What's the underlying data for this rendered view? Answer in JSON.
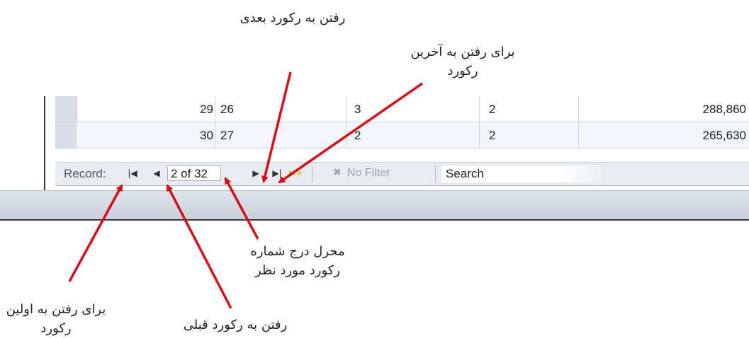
{
  "table": {
    "rows": [
      {
        "selector": "",
        "col1": "29",
        "col2": "26",
        "col3": "3",
        "col4": "2",
        "col5": "288,860"
      },
      {
        "selector": "",
        "col1": "30",
        "col2": "27",
        "col3": "2",
        "col4": "2",
        "col5": "265,630"
      }
    ]
  },
  "navbar": {
    "record_label": "Record:",
    "record_value": "2 of 32",
    "filter_label": "No Filter",
    "search_label": "Search",
    "icons": [
      "first-record-icon",
      "previous-record-icon",
      "next-record-icon",
      "last-record-icon",
      "new-record-icon",
      "filter-icon"
    ]
  },
  "annotations": {
    "next_record": "رفتن به رکورد بعدی",
    "last_record": "برای رفتن به آخرین رکورد",
    "record_input": "محرل درج شماره رکورد مورد نظر",
    "first_record": "برای رفتن به اولین رکورد",
    "previous_record": "رفتن به رکورد قبلی"
  },
  "colors": {
    "arrow": "#d40e1a",
    "new_record_icon": "#e8b400"
  }
}
